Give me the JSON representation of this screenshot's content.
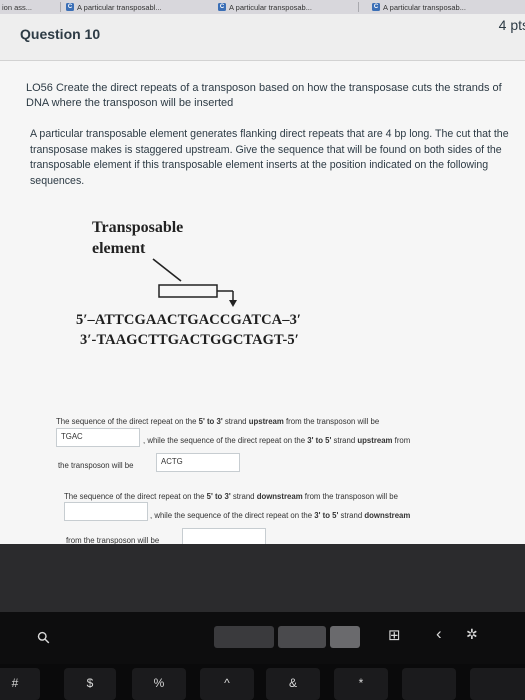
{
  "browser": {
    "tabs": [
      {
        "label": "ion ass...",
        "favicon": ""
      },
      {
        "label": "A particular transposabl...",
        "favicon": "C"
      },
      {
        "label": "A particular transposab...",
        "favicon": "C"
      },
      {
        "label": "A particular transposab...",
        "favicon": "C"
      }
    ]
  },
  "question": {
    "title": "Question 10",
    "points": "4 pts",
    "objective": "LO56 Create the direct repeats of a transposon based on how the transposase cuts the strands of DNA where the transposon will be inserted",
    "text": "A particular transposable element generates flanking direct repeats that are 4 bp long. The cut that the transposase makes is staggered upstream. Give the sequence that will be found on both sides of the transposable element if this transposable element inserts at the position indicated on the following sequences."
  },
  "figure": {
    "label": "Transposable element",
    "seq_top": "5′–ATTCGAACTGACCGATCA–3′",
    "seq_bottom": "3′-TAAGCTTGACTGGCTAGT-5′"
  },
  "answers": {
    "line1_pre": "The sequence of the direct repeat on the ",
    "line1_b1": "5' to 3'",
    "line1_mid": " strand ",
    "line1_b2": "upstream",
    "line1_post": " from the transposon will be",
    "input1_value": "TGAC",
    "line2_pre": ", while the sequence of the direct repeat on the ",
    "line2_b1": "3' to 5'",
    "line2_mid": " strand ",
    "line2_b2": "upstream",
    "line2_post": " from",
    "line3": "the transposon will be",
    "input2_value": "ACTG",
    "line4_pre": "The sequence of the direct repeat on the ",
    "line4_b1": "5' to 3'",
    "line4_mid": " strand ",
    "line4_b2": "downstream",
    "line4_post": " from the transposon will be",
    "input3_value": "",
    "line5_pre": ", while the sequence of the direct repeat on the ",
    "line5_b1": "3' to 5'",
    "line5_mid": " strand ",
    "line5_b2": "downstream",
    "line6": "from the transposon will be",
    "input4_value": ""
  },
  "keyboard": {
    "touchbar_icons": [
      "search-icon",
      "display-icon",
      "chevron-left-icon",
      "brightness-icon"
    ],
    "touchbar_glyphs": {
      "search": "⚲",
      "display": "⊞",
      "chevron": "‹",
      "brightness": "✲"
    },
    "keys": [
      "#",
      "$",
      "%",
      "^",
      "&",
      "*"
    ]
  },
  "colors": {
    "page_bg": "#f6f6f6",
    "text": "#2d3b45",
    "tab_favicon": "#3b6fb6"
  }
}
